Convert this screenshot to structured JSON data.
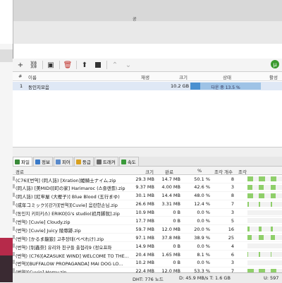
{
  "window": {
    "title": "공"
  },
  "toolbar": {
    "add": "+",
    "link": "⛓",
    "newfile": "▣",
    "remove": "🗑",
    "start": "⬆",
    "stop": "■",
    "up": "⌃",
    "down": "⌄",
    "status_icon": "μ"
  },
  "torrents": {
    "columns": {
      "num": "#",
      "name": "이름",
      "seeds": "재생",
      "size": "크기",
      "status": "상태",
      "peers": "활성"
    },
    "rows": [
      {
        "num": "1",
        "name": "동인지모음",
        "size": "10.2 GB",
        "status": "다운 중 13.5 %",
        "progress": 13.5
      }
    ]
  },
  "tabs": [
    {
      "label": "파일",
      "color": "#3a8a3a"
    },
    {
      "label": "정보",
      "color": "#3a7ac8"
    },
    {
      "label": "피어",
      "color": "#5a8acb"
    },
    {
      "label": "등급",
      "color": "#d8a020"
    },
    {
      "label": "트래커",
      "color": "#6a6a6a"
    },
    {
      "label": "속도",
      "color": "#3a9a3a"
    }
  ],
  "files": {
    "columns": {
      "path": "경로",
      "size": "크기",
      "done": "완료",
      "pct": "%",
      "pieces": "조각 개수",
      "chunks": "조각"
    },
    "rows": [
      {
        "name": "(C76)[번역] (同人誌) [Xration]姫騎士ナイム.zip",
        "size": "29.3 MB",
        "done": "14.7 MB",
        "pct": "50.1 %",
        "pieces": "8",
        "progress": 50.1
      },
      {
        "name": "(同人誌) [美MIDI][町の家] Harimaroc (스즐랜를).zip",
        "size": "9.37 MB",
        "done": "4.00 MB",
        "pct": "42.6 %",
        "pieces": "3",
        "progress": 42.6
      },
      {
        "name": "(同人誌) [紅牢屋 (大樫子)] Blue Blood (五行まゆ)",
        "size": "30.1 MB",
        "done": "14.4 MB",
        "pct": "48.0 %",
        "pieces": "8",
        "progress": 48.0
      },
      {
        "name": "(成年コミック)[강가][번역][Cuvie] 음란한손님.zip",
        "size": "26.6 MB",
        "done": "3.31 MB",
        "pct": "12.4 %",
        "pieces": "7",
        "progress": 12.4
      },
      {
        "name": "(동인지 키미키스) ERIKO[G's studio(初月脚就].zip",
        "size": "10.9 MB",
        "done": "0 B",
        "pct": "0.0 %",
        "pieces": "3",
        "progress": 0
      },
      {
        "name": "(번역) [Cuvie] Cloudy.zip",
        "size": "17.7 MB",
        "done": "0 B",
        "pct": "0.0 %",
        "pieces": "5",
        "progress": 0
      },
      {
        "name": "(번역) [Cuvie] Juicy 陵辱跡.zip",
        "size": "59.7 MB",
        "done": "12.0 MB",
        "pct": "20.0 %",
        "pieces": "16",
        "progress": 20.0
      },
      {
        "name": "(번역) [かるま龍狼] 고추장테(ぺぺれけ).zip",
        "size": "97.1 MB",
        "done": "37.8 MB",
        "pct": "38.9 %",
        "pieces": "25",
        "progress": 38.9
      },
      {
        "name": "(번역) [钊鑫奈] 유리와 친구들 출첩리9 (정오프파",
        "size": "14.9 MB",
        "done": "0 B",
        "pct": "0.0 %",
        "pieces": "4",
        "progress": 0
      },
      {
        "name": "(번역) (C76)[AZASUKE WIND] WELCOME TO THE...",
        "size": "20.4 MB",
        "done": "1.65 MB",
        "pct": "8.1 %",
        "pieces": "6",
        "progress": 8.1
      },
      {
        "name": "(번역)[BUFFALOW PROPAGANDA] MAI DOG LO...",
        "size": "10.2 MB",
        "done": "0 B",
        "pct": "0.0 %",
        "pieces": "3",
        "progress": 0
      },
      {
        "name": "(번역)[Cuvie] Horny.zip",
        "size": "22.4 MB",
        "done": "12.0 MB",
        "pct": "53.3 %",
        "pieces": "7",
        "progress": 53.3
      },
      {
        "name": "(번역)[DISCO...",
        "size": "12.1 MB",
        "done": "0 B",
        "pct": "0.0 %",
        "pieces": "4",
        "progress": 0
      }
    ]
  },
  "statusbar": {
    "dht": "DHT: 776 노드",
    "down": "D: 45.9 MB/s T: 1.6 GB",
    "up": "U: 597"
  },
  "colors": {
    "accent": "#4a90d0",
    "piece_done": "#8fcf6a",
    "selected_row": "#dfe8f5"
  }
}
